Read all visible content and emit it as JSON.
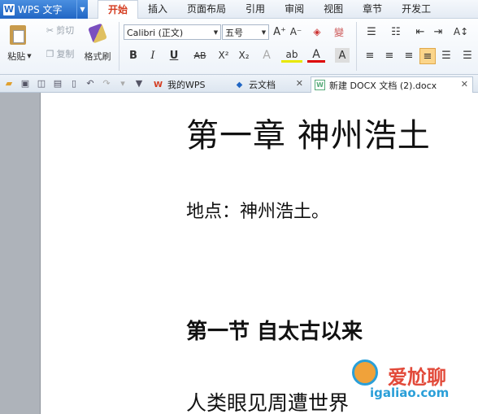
{
  "app": {
    "name": "WPS 文字",
    "logo_letter": "W"
  },
  "menu": {
    "tabs": [
      "开始",
      "插入",
      "页面布局",
      "引用",
      "审阅",
      "视图",
      "章节",
      "开发工"
    ]
  },
  "ribbon": {
    "paste": "粘贴",
    "cut": "剪切",
    "copy": "复制",
    "format_painter": "格式刷",
    "font_name": "Calibri (正文)",
    "font_size": "五号",
    "bold": "B",
    "italic": "I",
    "underline": "U",
    "strikethrough": "AB",
    "superscript": "X²",
    "subscript": "X₂"
  },
  "tabs": [
    {
      "label": "我的WPS"
    },
    {
      "label": "云文档"
    },
    {
      "label": "新建 DOCX 文档 (2).docx"
    }
  ],
  "document": {
    "title": "第一章    神州浩土",
    "location": "地点：神州浩土。",
    "section": "第一节  自太古以来",
    "body": "人类眼见周遭世界"
  },
  "watermark": {
    "line1": "爱尬聊",
    "line2": "igaliao.com"
  },
  "colors": {
    "accent": "#2166c4",
    "active_tab": "#d43b1f"
  }
}
